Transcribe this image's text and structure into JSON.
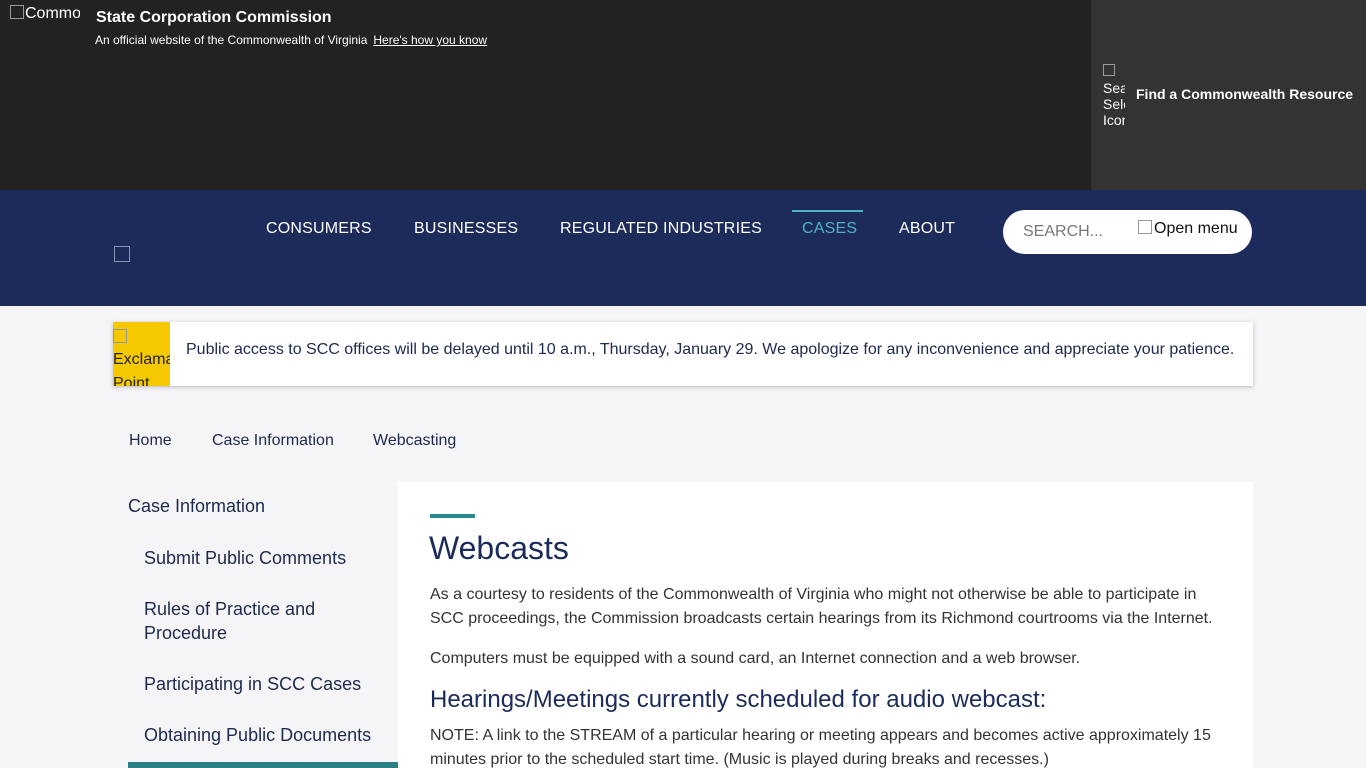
{
  "banner": {
    "logo_alt": "Commonwealth",
    "org_title": "State Corporation Commission",
    "official_text": "An official website of the Commonwealth of Virginia",
    "how_link": "Here's how you know",
    "resource_icon_alt": "Search Select Icon",
    "resource_label": "Find a Commonwealth Resource"
  },
  "nav": {
    "items": [
      {
        "label": "CONSUMERS"
      },
      {
        "label": "BUSINESSES"
      },
      {
        "label": "REGULATED INDUSTRIES"
      },
      {
        "label": "CASES"
      },
      {
        "label": "ABOUT"
      }
    ],
    "active": "CASES",
    "search_placeholder": "SEARCH...",
    "menu_alt": "Open menu"
  },
  "alert": {
    "icon_alt": "Exclamation Point",
    "text": "Public access to SCC offices will be delayed until 10 a.m., Thursday, January 29. We apologize for any inconvenience and appreciate your patience."
  },
  "breadcrumb": [
    "Home",
    "Case Information",
    "Webcasting"
  ],
  "sidebar": {
    "heading": "Case Information",
    "links": [
      "Submit Public Comments",
      "Rules of Practice and Procedure",
      "Participating in SCC Cases",
      "Obtaining Public Documents"
    ]
  },
  "content": {
    "title": "Webcasts",
    "para1": "As a courtesy to residents of the Commonwealth of Virginia who might not otherwise be able to participate in SCC proceedings, the Commission broadcasts certain hearings from its Richmond courtrooms via the Internet.",
    "para2": "Computers must be equipped with a sound card, an Internet connection and a web browser.",
    "subhead": "Hearings/Meetings currently scheduled for audio webcast:",
    "note": "NOTE: A link to the STREAM of a particular hearing or meeting appears and becomes active approximately 15 minutes prior to the scheduled start time. (Music is played during breaks and recesses.)"
  },
  "colors": {
    "banner_bg": "#222222",
    "resource_bg": "#333333",
    "nav_bg": "#1c2b5a",
    "accent_teal": "#4fb3bf",
    "alert_yellow": "#f6c800"
  }
}
